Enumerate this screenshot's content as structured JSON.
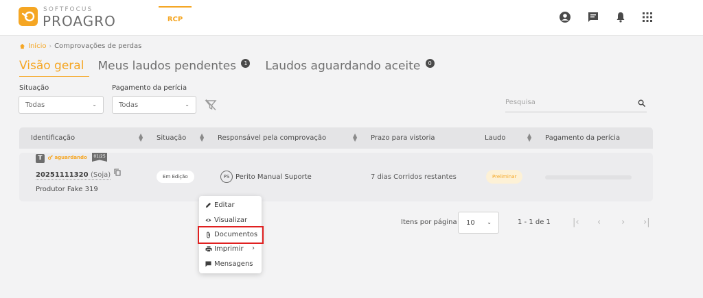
{
  "brand": {
    "company": "SOFTFOCUS",
    "product": "PROAGRO",
    "accent_color": "#f5a623"
  },
  "header": {
    "module_tab": "RCP",
    "icons": [
      "account-circle-icon",
      "chat-icon",
      "bell-icon",
      "apps-grid-icon"
    ]
  },
  "breadcrumb": {
    "home": "Início",
    "current": "Comprovações de perdas"
  },
  "tabs": [
    {
      "label": "Visão geral",
      "active": true
    },
    {
      "label": "Meus laudos pendentes",
      "badge": "1"
    },
    {
      "label": "Laudos aguardando aceite",
      "badge": "0"
    }
  ],
  "filters": {
    "situacao": {
      "label": "Situação",
      "value": "Todas"
    },
    "pagamento": {
      "label": "Pagamento da perícia",
      "value": "Todas"
    },
    "search_placeholder": "Pesquisa"
  },
  "table": {
    "columns": [
      "Identificação",
      "Situação",
      "Responsável pela comprovação",
      "Prazo para vistoria",
      "Laudo",
      "Pagamento da perícia"
    ],
    "rows": [
      {
        "type_badge": "T",
        "status_tag": "aguardando",
        "date_tag": "01/25",
        "id": "20251111320",
        "crop": "(Soja)",
        "producer": "Produtor Fake 319",
        "situacao": "Em Edição",
        "resp_initials": "PS",
        "resp_name": "Perito Manual Suporte",
        "prazo": "7 dias Corridos restantes",
        "laudo": "Preliminar",
        "pagamento_progress": 0
      }
    ]
  },
  "pagination": {
    "items_label": "Itens por página",
    "page_size": "10",
    "range": "1 - 1 de 1"
  },
  "context_menu": {
    "items": [
      {
        "label": "Editar",
        "icon": "pencil-icon"
      },
      {
        "label": "Visualizar",
        "icon": "eye-icon"
      },
      {
        "label": "Documentos",
        "icon": "paperclip-icon",
        "highlighted": true
      },
      {
        "label": "Imprimir",
        "icon": "printer-icon",
        "submenu": true
      },
      {
        "label": "Mensagens",
        "icon": "message-icon"
      }
    ],
    "highlight_color": "#e02020"
  }
}
